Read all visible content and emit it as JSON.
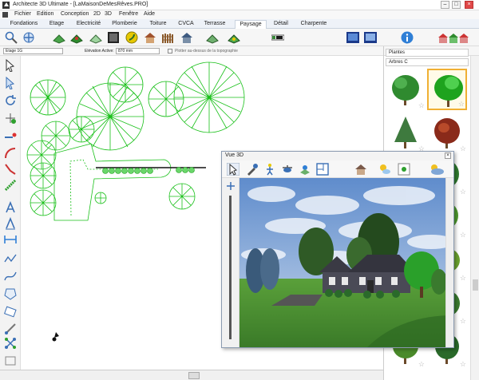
{
  "window": {
    "title": "Architecte 3D Ultimate - [LaMaisonDeMesRêves.PRO]"
  },
  "menu": [
    "Fichier",
    "Edition",
    "Conception",
    "2D",
    "3D",
    "Fenêtre",
    "Aide"
  ],
  "tabs": [
    "Fondations",
    "Etage",
    "Electricité",
    "Plomberie",
    "Toiture",
    "CVCA",
    "Terrasse",
    "Paysage",
    "Détail",
    "Charpente"
  ],
  "active_tab": "Paysage",
  "options": {
    "level_select": "Etage 1G",
    "elevation_label": "Elévation Active:",
    "elevation_value": "870 mm",
    "plot_label": "Plotter au-dessus de la topographie"
  },
  "library": {
    "category": "Plantes",
    "subcategory": "Arbres C"
  },
  "view3d": {
    "title": "Vue 3D",
    "close_glyph": "×"
  },
  "window_controls": {
    "minimize": "–",
    "restore": "□",
    "close": "×"
  },
  "icons": {
    "search": "search-icon",
    "move": "move-icon",
    "info": "info-icon",
    "house": "house-icon",
    "tree": "tree-icon",
    "star": "star-icon"
  },
  "colors": {
    "accent": "#2f7fd6",
    "plan_green": "#19c019",
    "selection": "#f0b034",
    "grass": "#3f8a2e",
    "sky": "#7fa6d6"
  }
}
